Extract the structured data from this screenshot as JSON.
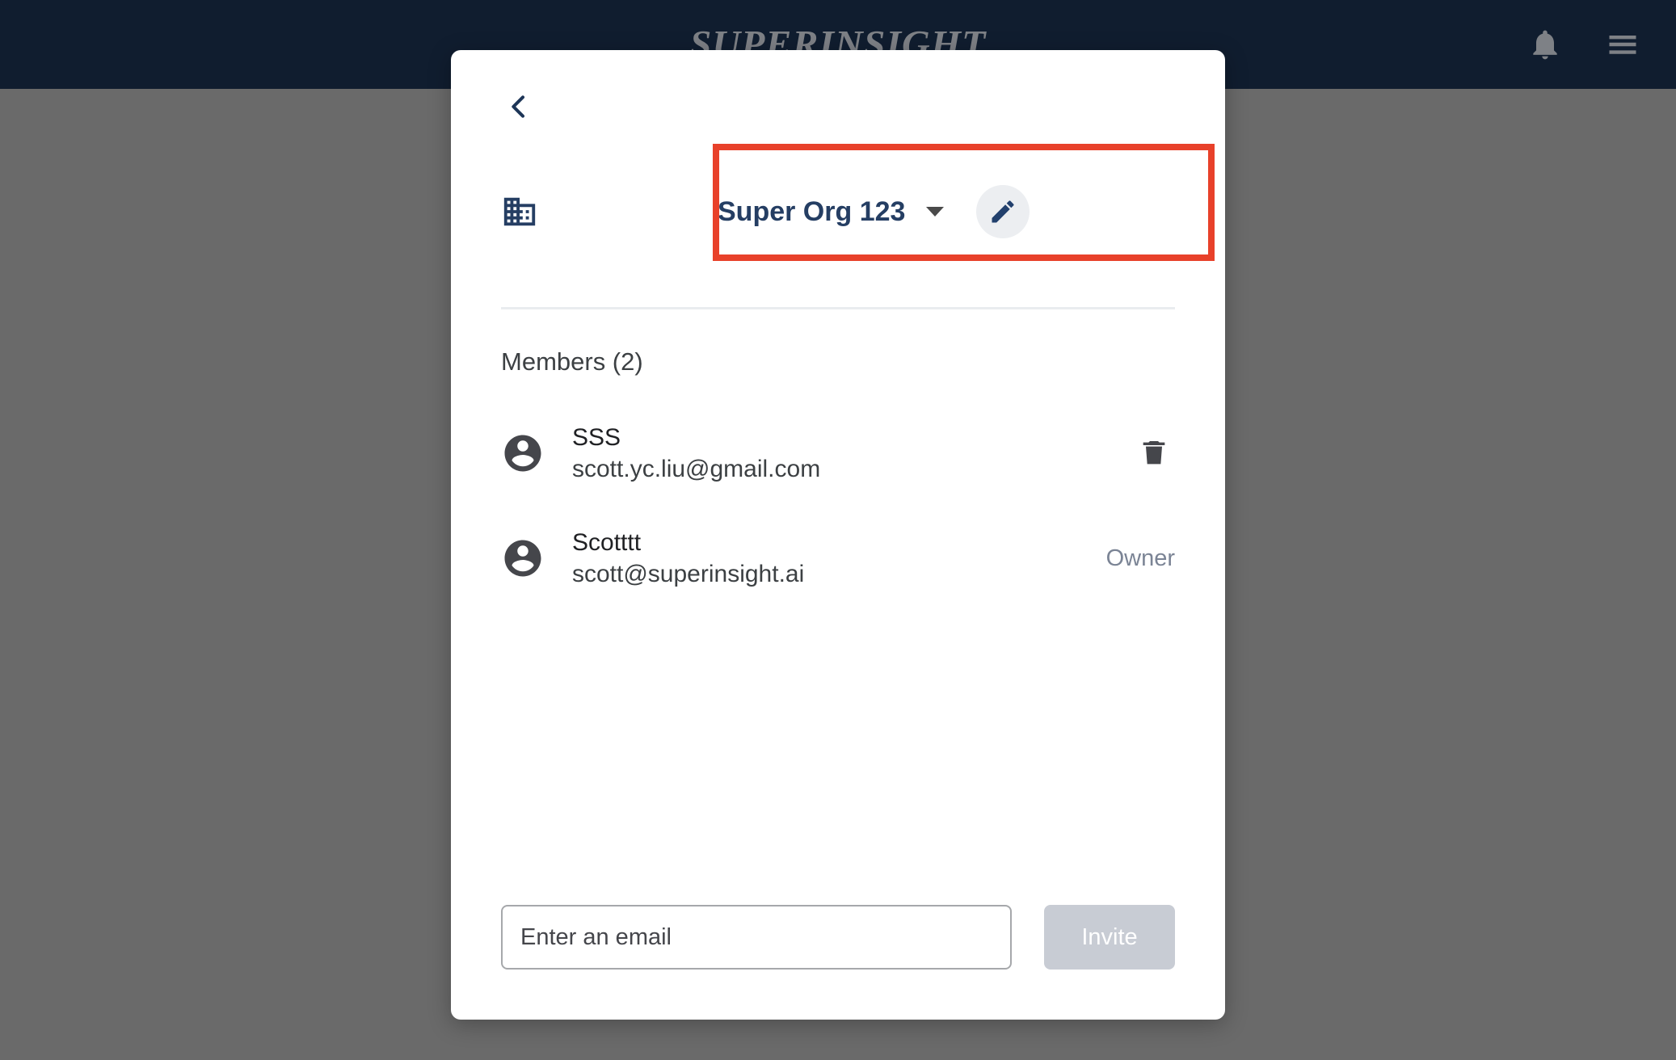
{
  "app": {
    "brand": "SUPERINSIGHT",
    "topbar": {
      "notification_icon": "bell-icon",
      "menu_icon": "hamburger-menu-icon"
    },
    "left_rail": [
      {
        "icon": "compare-arrows-icon",
        "name": "switch-tool"
      },
      {
        "icon": "person-add-icon",
        "name": "add-person-tool"
      }
    ]
  },
  "modal": {
    "back_icon": "chevron-left-icon",
    "org": {
      "icon": "domain-building-icon",
      "name": "Super Org 123",
      "dropdown_icon": "chevron-down-icon",
      "edit_icon": "pencil-edit-icon"
    },
    "members_heading": "Members (2)",
    "members": [
      {
        "avatar_icon": "account-circle-icon",
        "name": "SSS",
        "email": "scott.yc.liu@gmail.com",
        "action": "delete",
        "action_icon": "trash-icon",
        "role": ""
      },
      {
        "avatar_icon": "account-circle-icon",
        "name": "Scotttt",
        "email": "scott@superinsight.ai",
        "action": "role",
        "action_icon": "",
        "role": "Owner"
      }
    ],
    "invite": {
      "email_value": "",
      "email_placeholder": "Enter an email",
      "button_label": "Invite"
    }
  },
  "colors": {
    "topbar_bg": "#101d2f",
    "brand_text": "#7e8186",
    "accent_navy": "#253e63",
    "highlight_red": "#e8412a",
    "scrim": "#6a6a6a",
    "owner_text": "#7b8495",
    "invite_disabled_bg": "#c8ccd4"
  }
}
